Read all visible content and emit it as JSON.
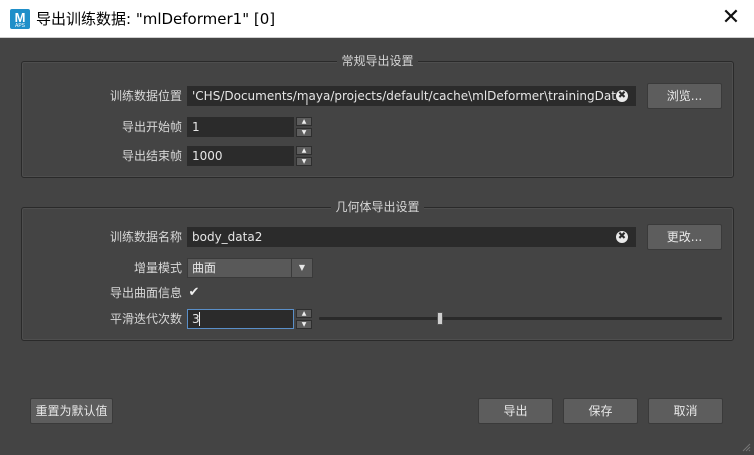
{
  "window": {
    "title": "导出训练数据: \"mlDeformer1\" [0]",
    "app_icon_letter": "M",
    "app_icon_sub": "APS",
    "close_symbol": "✕"
  },
  "general_group": {
    "title": "常规导出设置",
    "training_path_label": "训练数据位置",
    "training_path_value": "'CHS/Documents/maya/projects/default/cache\\mlDeformer\\trainingData",
    "browse_label": "浏览...",
    "start_frame_label": "导出开始帧",
    "start_frame_value": "1",
    "end_frame_label": "导出结束帧",
    "end_frame_value": "1000"
  },
  "geometry_group": {
    "title": "几何体导出设置",
    "name_label": "训练数据名称",
    "name_value": "body_data2",
    "change_label": "更改...",
    "delta_mode_label": "增量模式",
    "delta_mode_value": "曲面",
    "export_surface_info_label": "导出曲面信息",
    "export_surface_info_checked": true,
    "smooth_iterations_label": "平滑迭代次数",
    "smooth_iterations_value": "3",
    "smooth_slider_fraction": 0.3
  },
  "footer": {
    "reset_label": "重置为默认值",
    "export_label": "导出",
    "save_label": "保存",
    "cancel_label": "取消"
  },
  "icons": {
    "clear": "✖",
    "check": "✔",
    "up": "▲",
    "down": "▼"
  },
  "colors": {
    "background": "#444444",
    "field": "#2b2b2b",
    "button": "#5d5d5d",
    "focus_border": "#5a8fc8",
    "app_icon": "#1f8fc9"
  }
}
